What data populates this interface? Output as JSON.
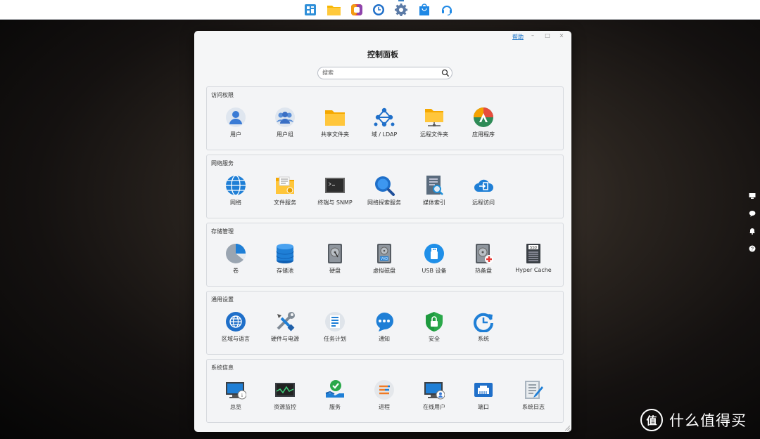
{
  "taskbar": {
    "icons": [
      "main-menu-icon",
      "file-station-icon",
      "photos-icon",
      "clock-icon",
      "control-panel-icon",
      "package-center-icon",
      "support-center-icon"
    ]
  },
  "window": {
    "title": "控制面板",
    "help": "帮助",
    "search_placeholder": "搜索"
  },
  "sections": [
    {
      "title": "访问权限",
      "items": [
        {
          "label": "用户",
          "icon": "user-icon"
        },
        {
          "label": "用户组",
          "icon": "user-group-icon"
        },
        {
          "label": "共享文件夹",
          "icon": "shared-folder-icon"
        },
        {
          "label": "域 / LDAP",
          "icon": "domain-ldap-icon"
        },
        {
          "label": "远程文件夹",
          "icon": "remote-folder-icon"
        },
        {
          "label": "应用程序",
          "icon": "application-privileges-icon"
        }
      ]
    },
    {
      "title": "网络服务",
      "items": [
        {
          "label": "网络",
          "icon": "network-icon"
        },
        {
          "label": "文件服务",
          "icon": "file-services-icon"
        },
        {
          "label": "终端与 SNMP",
          "icon": "terminal-icon"
        },
        {
          "label": "网络探索服务",
          "icon": "network-discovery-icon"
        },
        {
          "label": "媒体索引",
          "icon": "media-index-icon"
        },
        {
          "label": "远程访问",
          "icon": "remote-access-icon"
        }
      ]
    },
    {
      "title": "存储管理",
      "items": [
        {
          "label": "卷",
          "icon": "volume-icon"
        },
        {
          "label": "存储池",
          "icon": "storage-pool-icon"
        },
        {
          "label": "硬盘",
          "icon": "hdd-icon"
        },
        {
          "label": "虚拟磁盘",
          "icon": "virtual-disk-icon"
        },
        {
          "label": "USB 设备",
          "icon": "usb-icon"
        },
        {
          "label": "热备盘",
          "icon": "hot-spare-icon"
        },
        {
          "label": "Hyper Cache",
          "icon": "ssd-cache-icon"
        }
      ]
    },
    {
      "title": "通用设置",
      "items": [
        {
          "label": "区域与语言",
          "icon": "region-globe-icon"
        },
        {
          "label": "硬件与电源",
          "icon": "hardware-tools-icon"
        },
        {
          "label": "任务计划",
          "icon": "task-scheduler-icon"
        },
        {
          "label": "通知",
          "icon": "notification-icon"
        },
        {
          "label": "安全",
          "icon": "security-shield-icon"
        },
        {
          "label": "系统",
          "icon": "system-update-icon"
        }
      ]
    },
    {
      "title": "系统信息",
      "items": [
        {
          "label": "总览",
          "icon": "overview-icon"
        },
        {
          "label": "资源监控",
          "icon": "resource-monitor-icon"
        },
        {
          "label": "服务",
          "icon": "services-icon"
        },
        {
          "label": "进程",
          "icon": "process-icon"
        },
        {
          "label": "在线用户",
          "icon": "online-users-icon"
        },
        {
          "label": "端口",
          "icon": "port-icon"
        },
        {
          "label": "系统日志",
          "icon": "system-log-icon"
        }
      ]
    }
  ],
  "watermark": {
    "logo": "值",
    "text": "什么值得买"
  }
}
